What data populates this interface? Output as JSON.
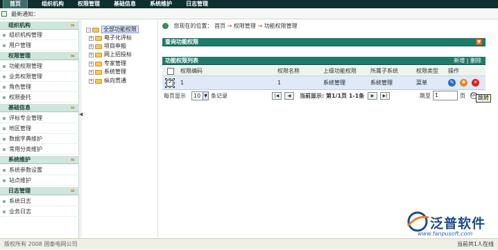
{
  "topnav": {
    "items": [
      {
        "label": "首页"
      },
      {
        "label": "组织机构"
      },
      {
        "label": "权限管理"
      },
      {
        "label": "基础信息"
      },
      {
        "label": "系统维护"
      },
      {
        "label": "日志管理"
      }
    ],
    "active_index": 0
  },
  "notice": {
    "label": "最新通知："
  },
  "sidebar": {
    "groups": [
      {
        "title": "组织机构",
        "chevron": "≈",
        "items": [
          "组织机构管理",
          "用户管理"
        ]
      },
      {
        "title": "权限管理",
        "chevron": "≈",
        "items": [
          "功能权限管理",
          "业务权限管理",
          "角色管理",
          "权限委托"
        ]
      },
      {
        "title": "基础信息",
        "chevron": "≈",
        "items": [
          "评标专业管理",
          "地区管理",
          "数据字典维护",
          "常用分类维护"
        ]
      },
      {
        "title": "系统维护",
        "chevron": "≈",
        "items": [
          "系统参数设置",
          "站点维护"
        ]
      },
      {
        "title": "日志管理",
        "chevron": "≈",
        "items": [
          "系统日志",
          "业务日志"
        ]
      }
    ]
  },
  "tree": {
    "root": "全部功能权限",
    "children": [
      "电子化评标",
      "项目申报",
      "网上招投标",
      "专家管理",
      "系统管理",
      "纵向贯通"
    ]
  },
  "breadcrumb": {
    "label": "您现在的位置：",
    "items": [
      "首页",
      "权限管理",
      "功能权限管理"
    ],
    "sep": "→"
  },
  "query_panel": {
    "title": "查询功能权限"
  },
  "list_panel": {
    "title": "功能权限列表",
    "add": "新增",
    "sep": "|",
    "delete": "删除"
  },
  "table": {
    "columns": [
      "权限编码",
      "权限名称",
      "上级功能权限",
      "所属子系统",
      "权限类型",
      "操作"
    ],
    "rows": [
      {
        "code": "1",
        "name": "1",
        "parent": "系统管理",
        "subsystem": "系统管理",
        "type": "菜单",
        "checked": true
      }
    ]
  },
  "pager": {
    "prefix": "每页显示",
    "page_size": "10",
    "suffix": "条记录",
    "status": "当前显示: 第1/1页 1-1条",
    "jump_label": "跳至",
    "jump_value": "1",
    "page_unit": "页",
    "go": "GO",
    "tooltip": "跳转"
  },
  "footer": {
    "left": "版权所有 2008 国泰电网公司",
    "right": "当前共1人在线"
  },
  "logo": {
    "text": "泛普软件",
    "url": "www.fanpusoft.com"
  },
  "icons": {
    "edit": "edit-icon",
    "settings": "settings-icon",
    "delete": "delete-icon"
  },
  "colors": {
    "nav": "#0d2f2f",
    "panel_header": "#1f7a6a",
    "sidebar_group": "#cfe6dc",
    "selected_row": "#dfe9f8"
  }
}
